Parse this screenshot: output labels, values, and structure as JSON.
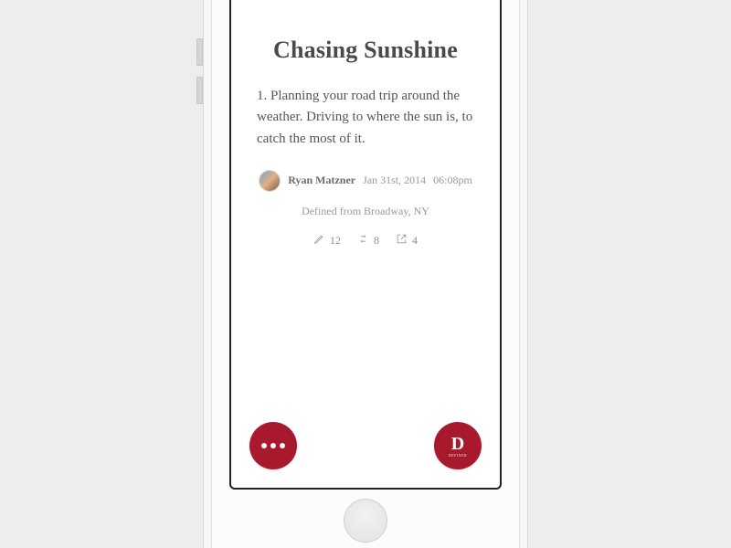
{
  "post": {
    "title": "Chasing Sunshine",
    "body": "1. Planning your road trip around the weather. Driving to where the sun is, to catch the most of it."
  },
  "author": {
    "name": "Ryan Matzner",
    "date": "Jan 31st, 2014",
    "time": "06:08pm"
  },
  "location": "Defined from Broadway, NY",
  "stats": {
    "edits": 12,
    "reposts": 8,
    "shares": 4
  },
  "logo": {
    "letter": "D",
    "sub": "DEFINER"
  },
  "colors": {
    "accent": "#a8192e"
  }
}
